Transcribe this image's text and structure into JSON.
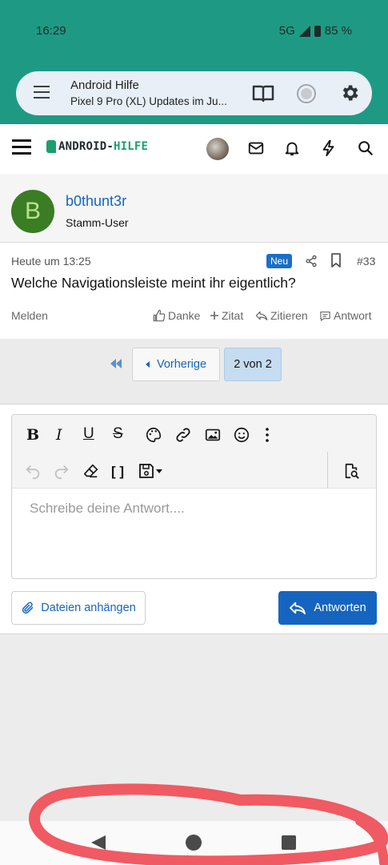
{
  "status": {
    "time": "16:29",
    "network": "5G",
    "battery": "85 %"
  },
  "custom_tab": {
    "title": "Android Hilfe",
    "subtitle": "Pixel 9 Pro (XL) Updates im Ju..."
  },
  "site": {
    "logo_main": "ANDROID-",
    "logo_accent": "HILFE"
  },
  "post": {
    "author_initial": "B",
    "author": "b0thunt3r",
    "role": "Stamm-User",
    "date": "Heute um 13:25",
    "badge": "Neu",
    "number": "#33",
    "text": "Welche Navigationsleiste meint ihr eigentlich?",
    "actions": {
      "report": "Melden",
      "thanks": "Danke",
      "quote": "Zitat",
      "multi_quote": "Zitieren",
      "answer": "Antwort"
    }
  },
  "pagination": {
    "prev": "Vorherige",
    "current": "2 von 2"
  },
  "editor": {
    "bold": "B",
    "italic": "I",
    "underline": "U",
    "strike": "S",
    "brackets": "[ ]",
    "placeholder": "Schreibe deine Antwort...."
  },
  "buttons": {
    "attach": "Dateien anhängen",
    "reply": "Antworten"
  },
  "colors": {
    "status_bg": "#1e9a84",
    "brand_green": "#1aa06d",
    "link_blue": "#1565c0",
    "annotation_red": "#f05a62"
  },
  "icons": [
    "menu-icon",
    "reader-mode-icon",
    "record-icon",
    "settings-gear-icon",
    "hamburger-icon",
    "mail-icon",
    "bell-icon",
    "bolt-icon",
    "search-icon",
    "share-icon",
    "bookmark-icon",
    "thumbs-up-icon",
    "plus-icon",
    "reply-icon",
    "comment-icon",
    "first-page-icon",
    "palette-icon",
    "link-icon",
    "image-icon",
    "emoji-icon",
    "more-icon",
    "undo-icon",
    "redo-icon",
    "eraser-icon",
    "save-draft-icon",
    "preview-icon",
    "paperclip-icon",
    "back-nav-icon",
    "home-nav-icon",
    "recents-nav-icon"
  ]
}
